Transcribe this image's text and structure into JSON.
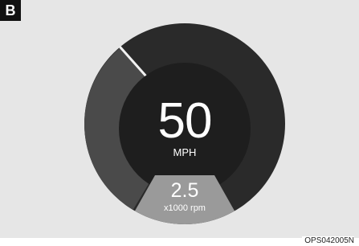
{
  "figure": {
    "label": "B",
    "code": "OPS042005N"
  },
  "speedometer": {
    "speed": "50",
    "speed_unit": "MPH",
    "rpm": "2.5",
    "rpm_unit": "x1000 rpm"
  },
  "colors": {
    "panel_background": "#e6e6e6",
    "gauge_outer": "#2a2a2a",
    "gauge_fill": "#4a4a4a",
    "gauge_inner": "#1e1e1e",
    "needle": "#f2f2f2",
    "rpm_segment": "#9a9a9a"
  }
}
